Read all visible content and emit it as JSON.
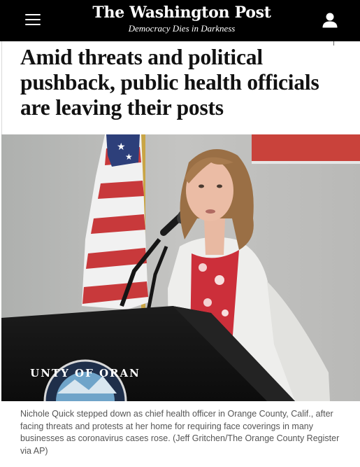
{
  "header": {
    "logo": "The Washington Post",
    "tagline": "Democracy Dies in Darkness",
    "menu_icon": "hamburger-menu-icon",
    "account_icon": "user-account-icon",
    "background": "#000000"
  },
  "article": {
    "headline": "Amid threats and political pushback, public health officials are leaving their posts",
    "photo_caption": "Nichole Quick stepped down as chief health officer in Orange County, Calif., after facing threats and protests at her home for requiring face coverings in many businesses as coronavirus cases rose. (Jeff Gritchen/The Orange County Register via AP)",
    "seal_text": "UNTY OF ORAN"
  }
}
